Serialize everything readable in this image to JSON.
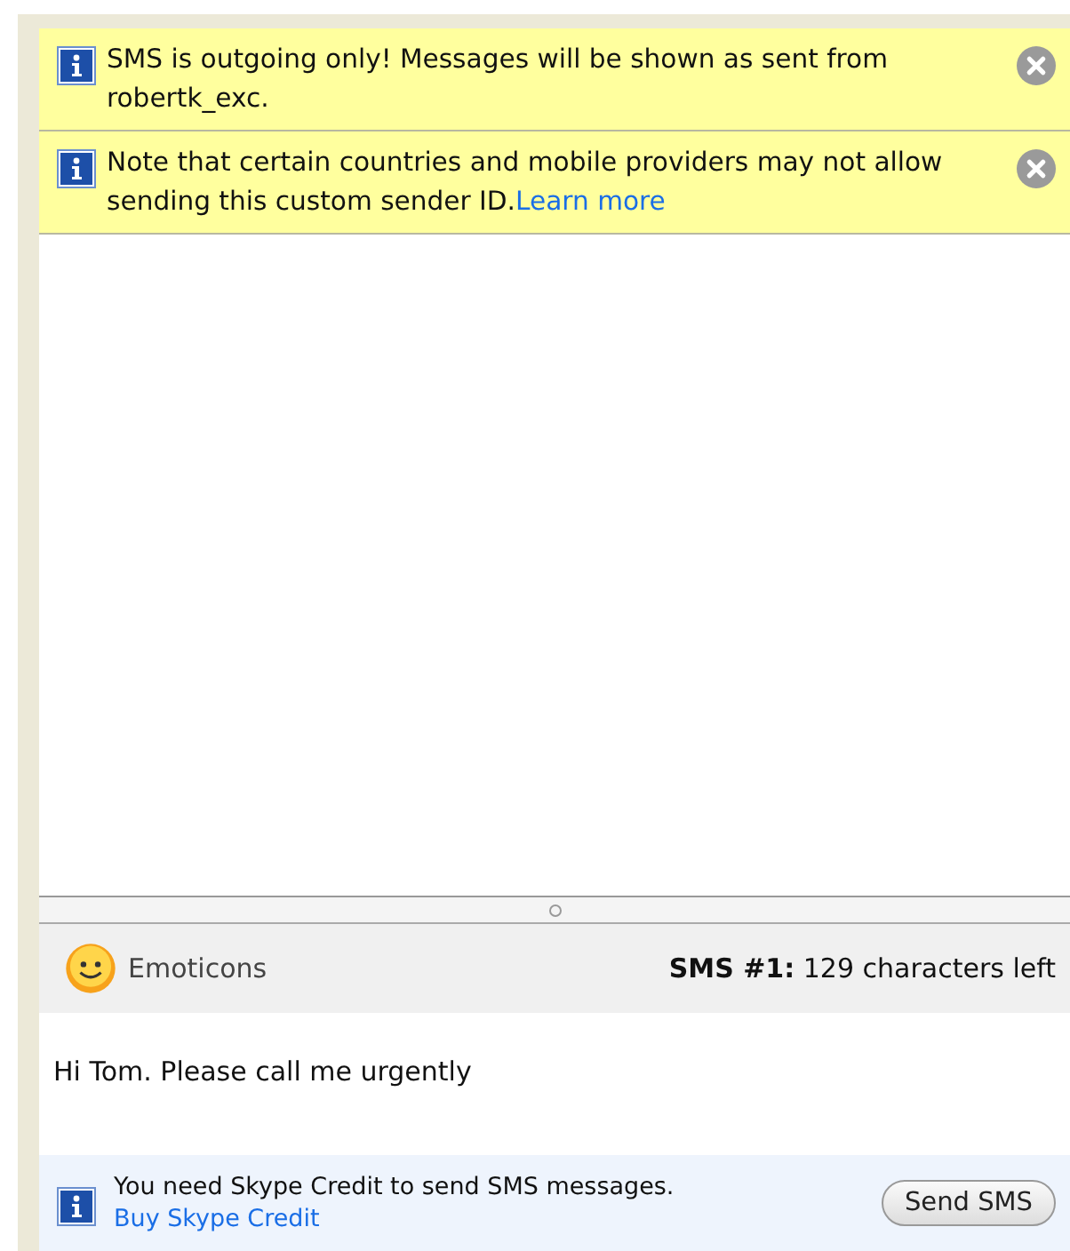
{
  "notices": [
    {
      "text": "SMS is outgoing only! Messages will be shown as sent from robertk_exc."
    },
    {
      "text": "Note that certain countries and mobile providers may not allow sending this custom sender ID.",
      "link": "Learn more"
    }
  ],
  "toolbar": {
    "emoticons": "Emoticons",
    "counter": "**SMS #1:** 129 characters left"
  },
  "message": {
    "value": "Hi Tom. Please call me urgently"
  },
  "credit": {
    "text": "You need Skype Credit to send SMS messages.",
    "link": "Buy Skype Credit",
    "button": "Send SMS"
  }
}
